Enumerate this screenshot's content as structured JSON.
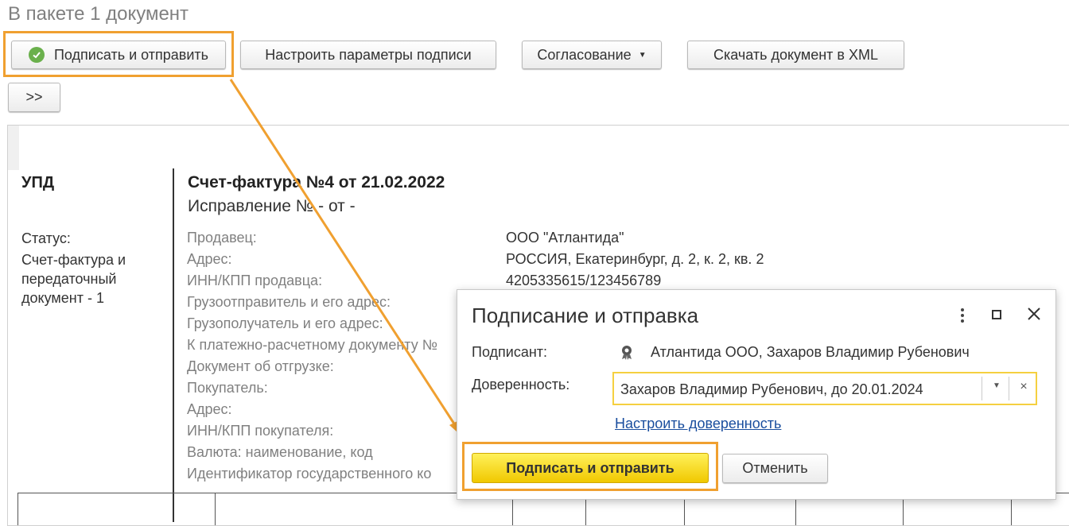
{
  "page": {
    "title": "В пакете 1 документ"
  },
  "toolbar": {
    "sign_send": "Подписать и отправить",
    "signature_params": "Настроить параметры подписи",
    "approval": "Согласование",
    "download_xml": "Скачать документ в XML",
    "more": ">>"
  },
  "document": {
    "type_label": "УПД",
    "status_label": "Статус:",
    "status_lines": [
      "Счет-фактура и",
      "передаточный",
      "документ - 1"
    ],
    "title": "Счет-фактура №4 от 21.02.2022",
    "correction": "Исправление № - от -",
    "fields": [
      {
        "label": "Продавец:",
        "value": "ООО \"Атлантида\""
      },
      {
        "label": "Адрес:",
        "value": "РОССИЯ, Екатеринбург, д. 2, к. 2, кв. 2"
      },
      {
        "label": "ИНН/КПП продавца:",
        "value": "4205335615/123456789"
      },
      {
        "label": "Грузоотправитель и его адрес:",
        "value": ""
      },
      {
        "label": "Грузополучатель и его адрес:",
        "value": ""
      },
      {
        "label": "К платежно-расчетному документу №",
        "value": ""
      },
      {
        "label": "Документ об отгрузке:",
        "value": ""
      },
      {
        "label": "Покупатель:",
        "value": ""
      },
      {
        "label": "Адрес:",
        "value": ""
      },
      {
        "label": "ИНН/КПП покупателя:",
        "value": ""
      },
      {
        "label": "Валюта: наименование, код",
        "value": ""
      },
      {
        "label": "Идентификатор государственного ко",
        "value": ""
      }
    ]
  },
  "dialog": {
    "title": "Подписание и отправка",
    "signer_label": "Подписант:",
    "signer_value": "Атлантида ООО, Захаров Владимир Рубенович",
    "poa_label": "Доверенность:",
    "poa_value": "Захаров Владимир Рубенович, до 20.01.2024",
    "configure_link": "Настроить доверенность",
    "sign_send_button": "Подписать и отправить",
    "cancel_button": "Отменить"
  },
  "colors": {
    "highlight": "#f0a030",
    "primary": "#f5d020",
    "link": "#1a4e9e"
  }
}
